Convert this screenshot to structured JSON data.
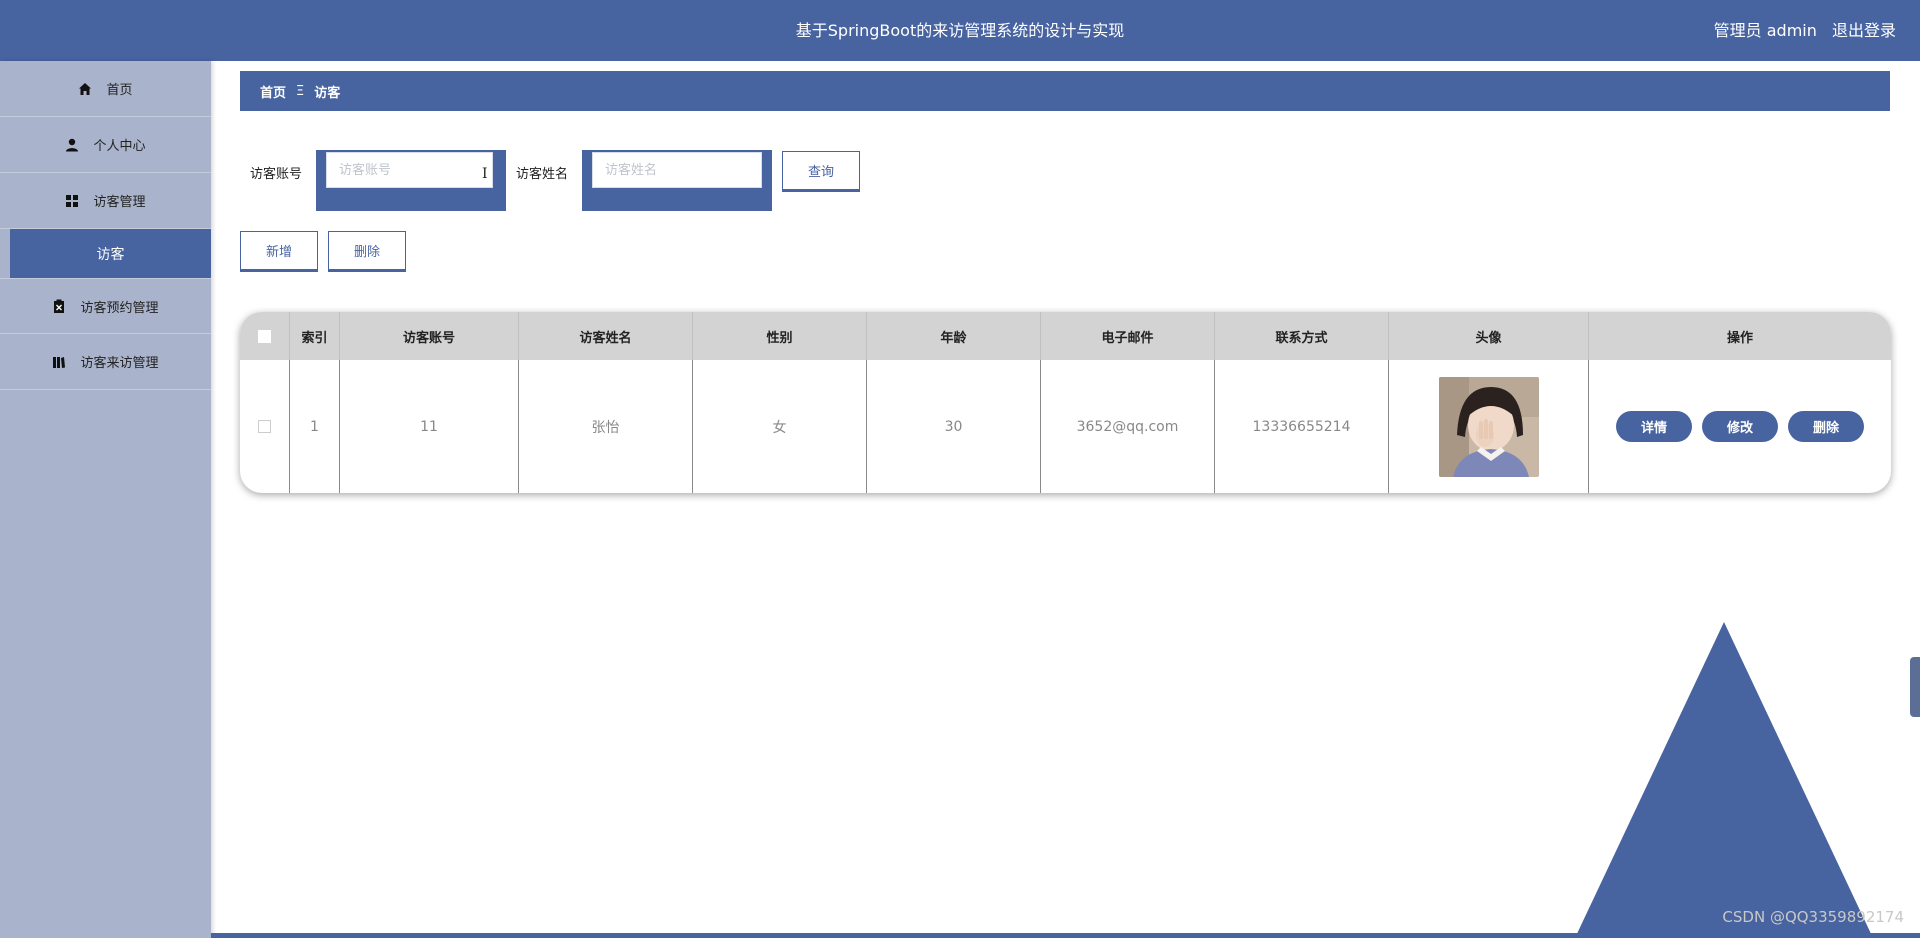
{
  "header": {
    "title": "基于SpringBoot的来访管理系统的设计与实现",
    "role_label": "管理员 admin",
    "logout_label": "退出登录"
  },
  "sidebar": {
    "items": [
      {
        "label": "首页",
        "icon": "home-icon"
      },
      {
        "label": "个人中心",
        "icon": "user-icon"
      },
      {
        "label": "访客管理",
        "icon": "grid-icon"
      },
      {
        "label": "访客",
        "active": true
      },
      {
        "label": "访客预约管理",
        "icon": "clipboard-icon"
      },
      {
        "label": "访客来访管理",
        "icon": "book-icon"
      }
    ]
  },
  "breadcrumb": {
    "home": "首页",
    "separator": "Ξ",
    "current": "访客"
  },
  "search": {
    "account_label": "访客账号",
    "account_placeholder": "访客账号",
    "name_label": "访客姓名",
    "name_placeholder": "访客姓名",
    "query_button": "查询"
  },
  "actions": {
    "add_button": "新增",
    "delete_button": "删除"
  },
  "table": {
    "columns": [
      "索引",
      "访客账号",
      "访客姓名",
      "性别",
      "年龄",
      "电子邮件",
      "联系方式",
      "头像",
      "操作"
    ],
    "rows": [
      {
        "index": "1",
        "account": "11",
        "name": "张怡",
        "gender": "女",
        "age": "30",
        "email": "3652@qq.com",
        "phone": "13336655214",
        "avatar": "photo",
        "actions": [
          "详情",
          "修改",
          "删除"
        ]
      }
    ]
  },
  "watermark": "CSDN @QQ3359892174",
  "colors": {
    "accent": "#4763a0",
    "sidebar": "#a9b3cb",
    "table_header": "#d3d3d3"
  }
}
